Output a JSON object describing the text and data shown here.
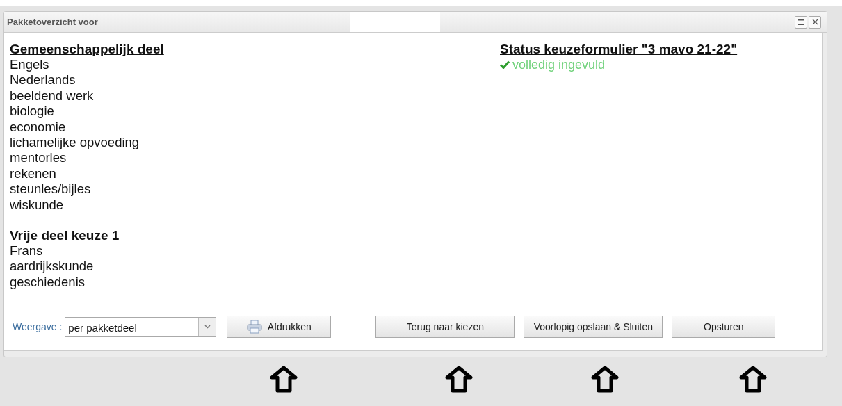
{
  "window": {
    "title": "Pakketoverzicht voor"
  },
  "sections": [
    {
      "heading": "Gemeenschappelijk deel",
      "items": [
        "Engels",
        "Nederlands",
        "beeldend werk",
        "biologie",
        "economie",
        "lichamelijke opvoeding",
        "mentorles",
        "rekenen",
        "steunles/bijles",
        "wiskunde"
      ]
    },
    {
      "heading": "Vrije deel keuze 1",
      "items": [
        "Frans",
        "aardrijkskunde",
        "geschiedenis"
      ]
    }
  ],
  "status": {
    "heading": "Status keuzeformulier \"3 mavo 21-22\"",
    "text": "volledig ingevuld",
    "complete": true
  },
  "view": {
    "label": "Weergave :",
    "value": "per pakketdeel"
  },
  "buttons": [
    {
      "label": "Afdrukken",
      "kind": "print"
    },
    {
      "label": "Terug naar kiezen",
      "kind": "plain"
    },
    {
      "label": "Voorlopig opslaan & Sluiten",
      "kind": "plain"
    },
    {
      "label": "Opsturen",
      "kind": "plain"
    }
  ]
}
